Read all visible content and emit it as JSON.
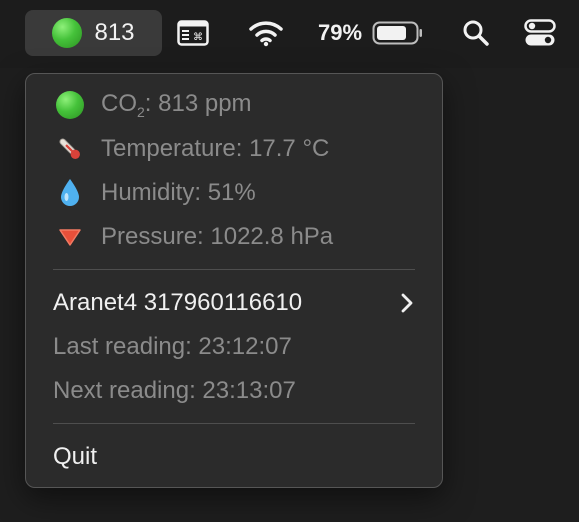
{
  "menubar": {
    "co2_value": "813",
    "battery_percent": "79%",
    "icons": [
      "status-dot-icon",
      "window-command-icon",
      "wifi-icon",
      "battery-icon",
      "search-icon",
      "control-center-icon"
    ]
  },
  "menu": {
    "readings": {
      "co2_prefix": "CO",
      "co2_sub": "2",
      "co2_rest": ": 813 ppm",
      "temperature": "Temperature: 17.7 °C",
      "humidity": "Humidity: 51%",
      "pressure": "Pressure: 1022.8 hPa"
    },
    "device_name": "Aranet4 317960116610",
    "last_reading": "Last reading: 23:12:07",
    "next_reading": "Next reading: 23:13:07",
    "quit_label": "Quit"
  },
  "colors": {
    "status_green": "#45c23a",
    "menu_bg": "#2b2b2b",
    "dim_text": "#8b8b8b",
    "bright_text": "#f0f0f0"
  }
}
